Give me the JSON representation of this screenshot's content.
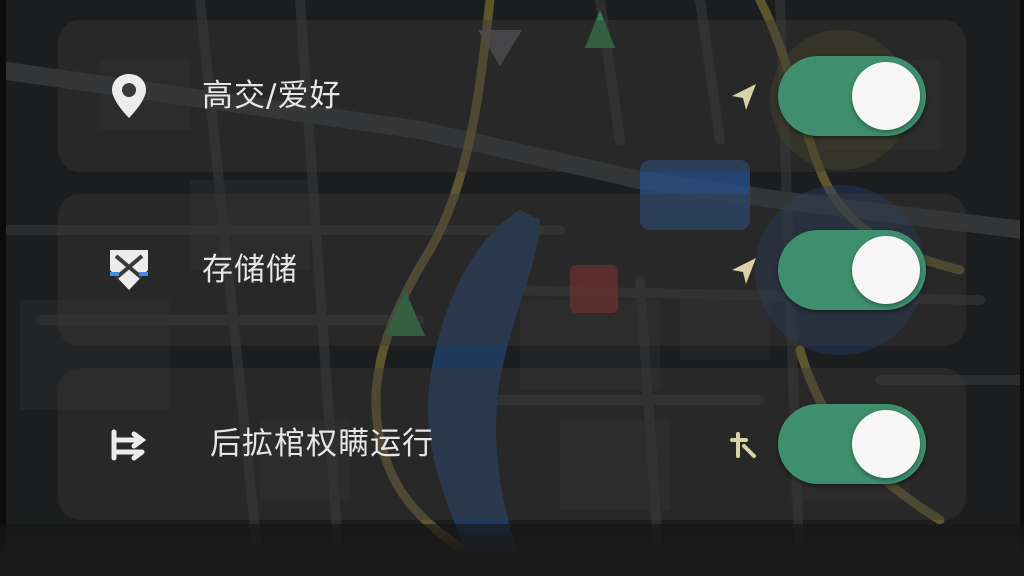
{
  "settings": {
    "items": [
      {
        "label": "高交/爱好",
        "icon": "location-pin-icon",
        "marker": "navigation-arrow-icon",
        "enabled": true
      },
      {
        "label": "存储储",
        "icon": "storage-icon",
        "marker": "navigation-arrow-icon",
        "enabled": true
      },
      {
        "label": "后拡棺权瞒运行",
        "icon": "route-swap-icon",
        "marker": "route-marker-icon",
        "enabled": true
      }
    ]
  },
  "colors": {
    "toggle_on": "#3f8f6f",
    "knob": "#f6f6f6",
    "card_bg": "#3a3a3a",
    "text": "#e6e6e6",
    "marker": "#d8d2a6"
  }
}
